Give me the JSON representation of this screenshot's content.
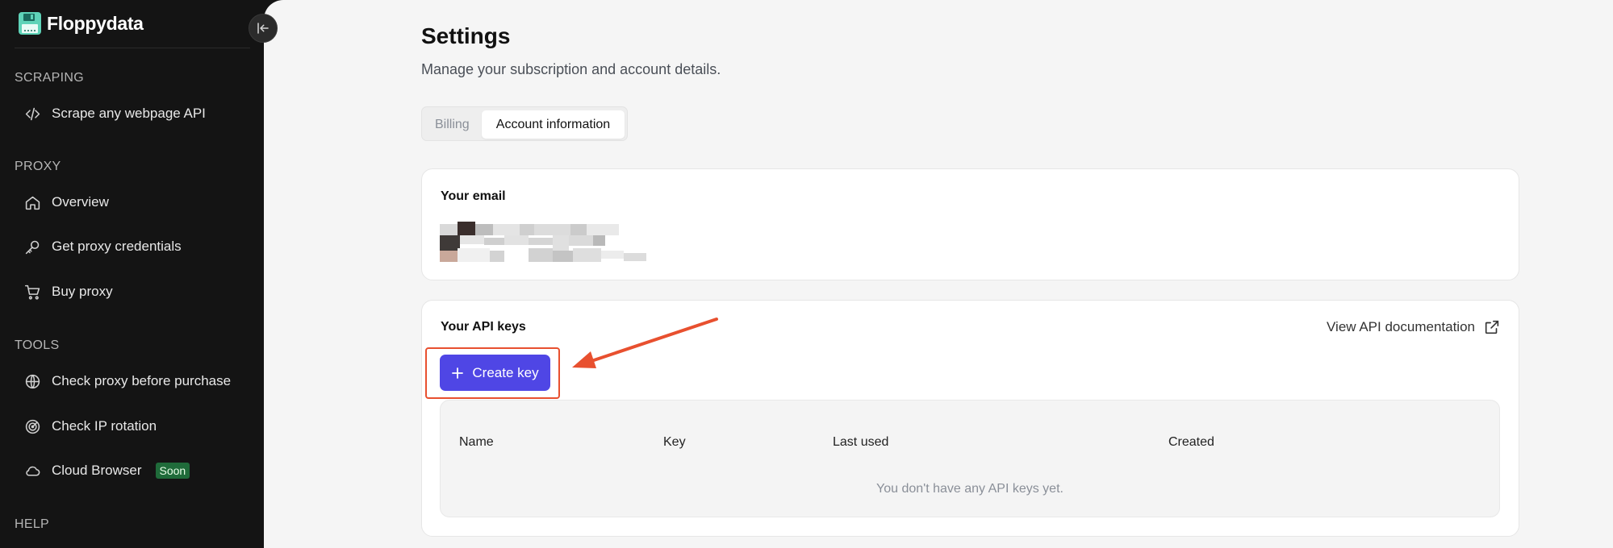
{
  "brand": {
    "name": "Floppydata",
    "icon": "floppy-disk-icon"
  },
  "sidebar": {
    "sections": [
      {
        "label": "SCRAPING",
        "items": [
          {
            "label": "Scrape any webpage API",
            "icon": "code-icon"
          }
        ]
      },
      {
        "label": "PROXY",
        "items": [
          {
            "label": "Overview",
            "icon": "home-icon"
          },
          {
            "label": "Get proxy credentials",
            "icon": "key-icon"
          },
          {
            "label": "Buy proxy",
            "icon": "cart-icon"
          }
        ]
      },
      {
        "label": "TOOLS",
        "items": [
          {
            "label": "Check proxy before purchase",
            "icon": "globe-icon"
          },
          {
            "label": "Check IP rotation",
            "icon": "radar-icon"
          },
          {
            "label": "Cloud Browser",
            "icon": "cloud-icon",
            "badge": "Soon"
          }
        ]
      },
      {
        "label": "HELP",
        "items": []
      }
    ]
  },
  "page": {
    "title": "Settings",
    "subtitle": "Manage your subscription and account details."
  },
  "tabs": [
    {
      "label": "Billing",
      "active": false
    },
    {
      "label": "Account information",
      "active": true
    }
  ],
  "email_card": {
    "heading": "Your email"
  },
  "api_card": {
    "heading": "Your API keys",
    "doc_link": "View API documentation",
    "create_button": "Create key",
    "table": {
      "columns": [
        "Name",
        "Key",
        "Last used",
        "Created"
      ],
      "empty_message": "You don't have any API keys yet."
    }
  },
  "colors": {
    "sidebar_bg": "#141414",
    "accent": "#4f46e5",
    "annotation": "#e8502f",
    "badge_bg": "#1f6b3a",
    "brand_icon": "#5fd3b8"
  }
}
